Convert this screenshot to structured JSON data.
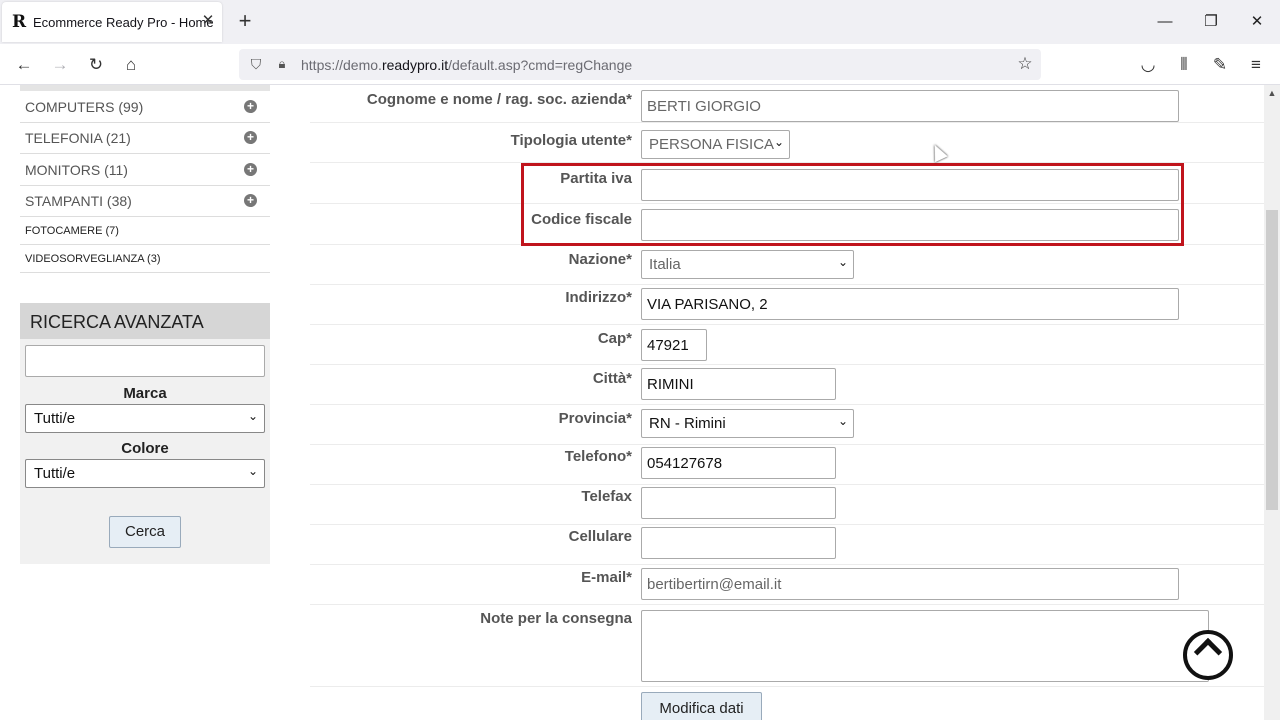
{
  "browser": {
    "tab_title": "Ecommerce Ready Pro - Home",
    "tab_favicon": "R",
    "url_prefix": "https://demo.",
    "url_host": "readypro.it",
    "url_path": "/default.asp?cmd=regChange"
  },
  "sidebar": {
    "categories": [
      {
        "label": "COMPUTERS (99)"
      },
      {
        "label": "TELEFONIA (21)"
      },
      {
        "label": "MONITORS (11)"
      },
      {
        "label": "STAMPANTI (38)"
      },
      {
        "label": "FOTOCAMERE (7)"
      },
      {
        "label": "VIDEOSORVEGLIANZA (3)"
      }
    ],
    "search": {
      "title": "RICERCA AVANZATA",
      "query": "",
      "brand_label": "Marca",
      "brand_value": "Tutti/e",
      "color_label": "Colore",
      "color_value": "Tutti/e",
      "submit_label": "Cerca"
    }
  },
  "form": {
    "name_label": "Cognome e nome / rag. soc. azienda*",
    "name_value": "BERTI GIORGIO",
    "user_type_label": "Tipologia utente*",
    "user_type_value": "PERSONA FISICA",
    "vat_label": "Partita iva",
    "vat_value": "",
    "tax_code_label": "Codice fiscale",
    "tax_code_value": "",
    "country_label": "Nazione*",
    "country_value": "Italia",
    "address_label": "Indirizzo*",
    "address_value": "VIA PARISANO, 2",
    "zip_label": "Cap*",
    "zip_value": "47921",
    "city_label": "Città*",
    "city_value": "RIMINI",
    "province_label": "Provincia*",
    "province_value": "RN - Rimini",
    "phone_label": "Telefono*",
    "phone_value": "054127678",
    "fax_label": "Telefax",
    "fax_value": "",
    "mobile_label": "Cellulare",
    "mobile_value": "",
    "email_label": "E-mail*",
    "email_value": "bertibertirn@email.it",
    "notes_label": "Note per la consegna",
    "notes_value": "",
    "submit_label": "Modifica dati"
  },
  "colors": {
    "highlight": "#c0141c",
    "button_bg": "#e6eef5"
  }
}
